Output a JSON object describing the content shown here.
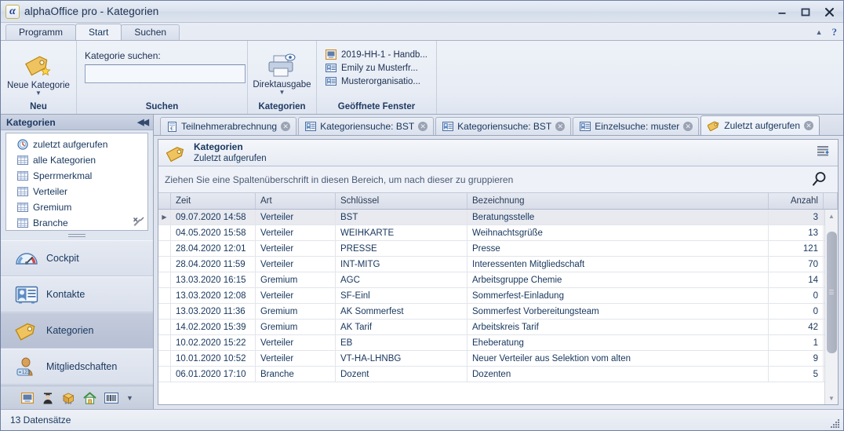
{
  "window": {
    "title": "alphaOffice pro - Kategorien",
    "logo_glyph": "α",
    "minimize_label": "Minimieren",
    "maximize_label": "Maximieren",
    "close_label": "Schließen"
  },
  "ribbon": {
    "tabs": [
      {
        "label": "Programm",
        "active": false
      },
      {
        "label": "Start",
        "active": true
      },
      {
        "label": "Suchen",
        "active": false
      }
    ],
    "groups": {
      "neu": {
        "label": "Neu",
        "button": {
          "label": "Neue Kategorie",
          "icon": "category-tag-new-icon"
        }
      },
      "suchen": {
        "label": "Suchen",
        "field_label": "Kategorie suchen:",
        "field_value": "",
        "field_placeholder": ""
      },
      "kategorien": {
        "label": "Kategorien",
        "button": {
          "label": "Direktausgabe",
          "icon": "printer-preview-icon"
        }
      },
      "fenster": {
        "label": "Geöffnete Fenster",
        "items": [
          {
            "label": "2019-HH-1 - Handb...",
            "icon": "window-icon"
          },
          {
            "label": "Emily zu Musterfr...",
            "icon": "contact-card-icon"
          },
          {
            "label": "Musterorganisatio...",
            "icon": "contact-card-icon"
          }
        ]
      }
    }
  },
  "sidebar": {
    "header": {
      "title": "Kategorien",
      "collapse_icon": "double-chevron-left-icon"
    },
    "items": [
      {
        "label": "zuletzt aufgerufen",
        "icon": "recent-clock-icon"
      },
      {
        "label": "alle Kategorien",
        "icon": "table-grid-icon"
      },
      {
        "label": "Sperrmerkmal",
        "icon": "table-grid-icon"
      },
      {
        "label": "Verteiler",
        "icon": "table-grid-icon"
      },
      {
        "label": "Gremium",
        "icon": "table-grid-icon"
      },
      {
        "label": "Branche",
        "icon": "table-grid-icon"
      }
    ],
    "tools_icon": "tools-wrench-icon",
    "modules": [
      {
        "label": "Cockpit",
        "icon": "gauge-icon",
        "selected": false
      },
      {
        "label": "Kontakte",
        "icon": "contact-card-big-icon",
        "selected": false
      },
      {
        "label": "Kategorien",
        "icon": "category-tag-icon",
        "selected": true
      },
      {
        "label": "Mitgliedschaften",
        "icon": "member-person-icon",
        "selected": false
      }
    ],
    "quick_icons": [
      {
        "name": "window-icon"
      },
      {
        "name": "lecturer-person-icon"
      },
      {
        "name": "package-cart-icon"
      },
      {
        "name": "home-icon"
      },
      {
        "name": "barcode-icon"
      },
      {
        "name": "chevron-down-icon"
      }
    ]
  },
  "document_tabs": [
    {
      "label": "Teilnehmerabrechnung",
      "icon": "invoice-euro-icon",
      "active": false
    },
    {
      "label": "Kategoriensuche: BST",
      "icon": "contact-card-icon",
      "active": false
    },
    {
      "label": "Kategoriensuche: BST",
      "icon": "contact-card-icon",
      "active": false
    },
    {
      "label": "Einzelsuche: muster",
      "icon": "contact-card-icon",
      "active": false
    },
    {
      "label": "Zuletzt aufgerufen",
      "icon": "category-tag-icon",
      "active": true
    }
  ],
  "panel": {
    "title": "Kategorien",
    "subtitle": "Zuletzt aufgerufen",
    "header_icon": "category-tag-icon",
    "layout_icon": "column-layout-icon",
    "group_hint": "Ziehen Sie eine Spaltenüberschrift in diesen Bereich, um nach dieser zu gruppieren",
    "search_icon": "magnifier-icon"
  },
  "grid": {
    "columns": [
      "Zeit",
      "Art",
      "Schlüssel",
      "Bezeichnung",
      "Anzahl"
    ],
    "selected_row_index": 0,
    "rows": [
      {
        "zeit": "09.07.2020 14:58",
        "art": "Verteiler",
        "schluessel": "BST",
        "bezeichnung": "Beratungsstelle",
        "anzahl": "3"
      },
      {
        "zeit": "04.05.2020 15:58",
        "art": "Verteiler",
        "schluessel": "WEIHKARTE",
        "bezeichnung": "Weihnachtsgrüße",
        "anzahl": "13"
      },
      {
        "zeit": "28.04.2020 12:01",
        "art": "Verteiler",
        "schluessel": "PRESSE",
        "bezeichnung": "Presse",
        "anzahl": "121"
      },
      {
        "zeit": "28.04.2020 11:59",
        "art": "Verteiler",
        "schluessel": "INT-MITG",
        "bezeichnung": "Interessenten Mitgliedschaft",
        "anzahl": "70"
      },
      {
        "zeit": "13.03.2020 16:15",
        "art": "Gremium",
        "schluessel": "AGC",
        "bezeichnung": "Arbeitsgruppe Chemie",
        "anzahl": "14"
      },
      {
        "zeit": "13.03.2020 12:08",
        "art": "Verteiler",
        "schluessel": "SF-Einl",
        "bezeichnung": "Sommerfest-Einladung",
        "anzahl": "0"
      },
      {
        "zeit": "13.03.2020 11:36",
        "art": "Gremium",
        "schluessel": "AK Sommerfest",
        "bezeichnung": "Sommerfest Vorbereitungsteam",
        "anzahl": "0"
      },
      {
        "zeit": "14.02.2020 15:39",
        "art": "Gremium",
        "schluessel": "AK Tarif",
        "bezeichnung": "Arbeitskreis Tarif",
        "anzahl": "42"
      },
      {
        "zeit": "10.02.2020 15:22",
        "art": "Verteiler",
        "schluessel": "EB",
        "bezeichnung": "Eheberatung",
        "anzahl": "1"
      },
      {
        "zeit": "10.01.2020 10:52",
        "art": "Verteiler",
        "schluessel": "VT-HA-LHNBG",
        "bezeichnung": "Neuer Verteiler aus Selektion vom alten",
        "anzahl": "9"
      },
      {
        "zeit": "06.01.2020 17:10",
        "art": "Branche",
        "schluessel": "Dozent",
        "bezeichnung": "Dozenten",
        "anzahl": "5"
      }
    ]
  },
  "statusbar": {
    "record_count": "13 Datensätze"
  },
  "colors": {
    "accent": "#17365d",
    "chrome": "#dde3ee",
    "selected_nav": "#c3cbdc",
    "gold": "#e8b84b"
  }
}
